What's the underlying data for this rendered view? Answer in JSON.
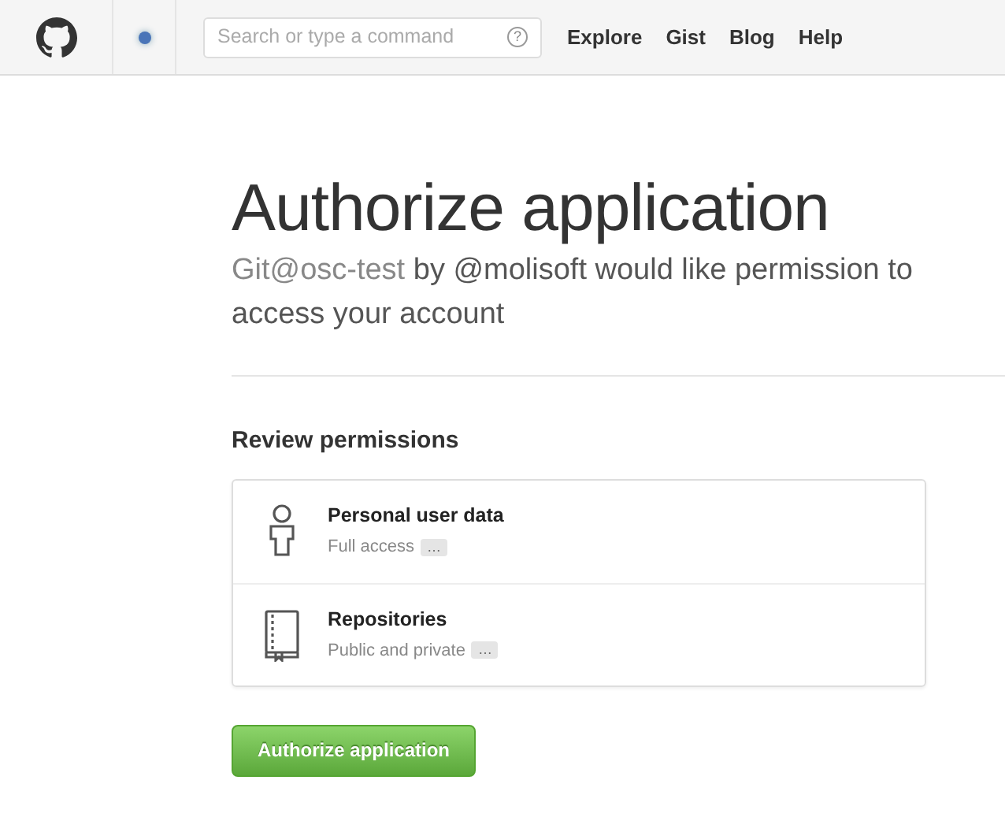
{
  "header": {
    "search": {
      "placeholder": "Search or type a command",
      "help": "?"
    },
    "nav": [
      "Explore",
      "Gist",
      "Blog",
      "Help"
    ]
  },
  "title": "Authorize application",
  "description": {
    "app": "Git@osc-test",
    "text": "by @molisoft would like permission to access your account"
  },
  "permissions": {
    "heading": "Review permissions",
    "items": [
      {
        "kind": "user",
        "name": "Personal user data",
        "detail": "Full access",
        "more": "…"
      },
      {
        "kind": "repo",
        "name": "Repositories",
        "detail": "Public and private",
        "more": "…"
      }
    ]
  },
  "button": "Authorize application"
}
